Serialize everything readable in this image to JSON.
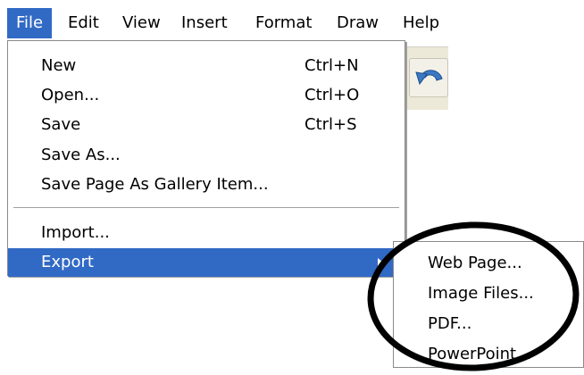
{
  "menubar": {
    "file": "File",
    "edit": "Edit",
    "view": "View",
    "insert": "Insert",
    "format": "Format",
    "draw": "Draw",
    "help": "Help"
  },
  "file_menu": {
    "items": [
      {
        "label": "New",
        "shortcut": "Ctrl+N"
      },
      {
        "label": "Open...",
        "shortcut": "Ctrl+O"
      },
      {
        "label": "Save",
        "shortcut": "Ctrl+S"
      },
      {
        "label": "Save As...",
        "shortcut": ""
      },
      {
        "label": "Save Page As Gallery Item...",
        "shortcut": ""
      },
      {
        "label": "Import...",
        "shortcut": ""
      },
      {
        "label": "Export",
        "shortcut": ""
      }
    ]
  },
  "export_submenu": {
    "items": [
      {
        "label": "Web Page..."
      },
      {
        "label": "Image Files..."
      },
      {
        "label": "PDF..."
      },
      {
        "label": "PowerPoint..."
      }
    ]
  },
  "toolbar": {
    "icons": [
      "undo-icon"
    ]
  },
  "colors": {
    "highlight": "#316ac5",
    "circle": "#000000"
  }
}
